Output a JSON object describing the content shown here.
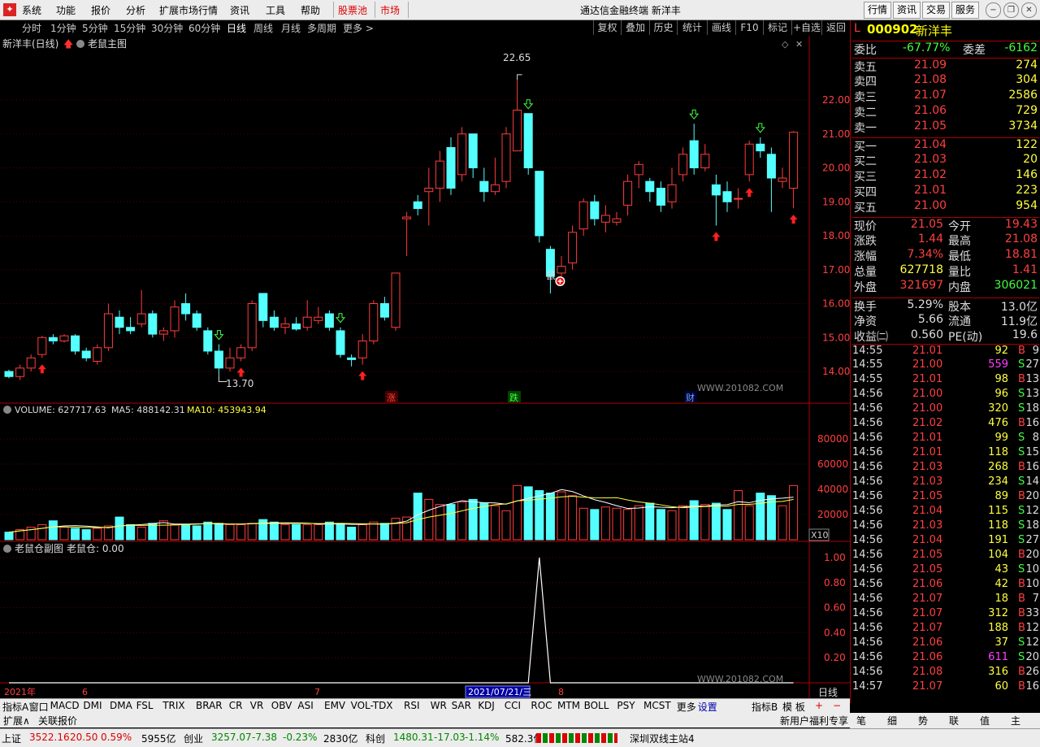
{
  "menu": {
    "items": [
      "系统",
      "功能",
      "报价",
      "分析",
      "扩展市场行情",
      "资讯",
      "工具",
      "帮助"
    ],
    "hot": "股票池",
    "market": "市场",
    "title": "通达信金融终端  新洋丰",
    "right_buttons": [
      "行情",
      "资讯",
      "交易",
      "服务"
    ]
  },
  "periods": [
    "分时",
    "1分钟",
    "5分钟",
    "15分钟",
    "30分钟",
    "60分钟",
    "日线",
    "周线",
    "月线",
    "多周期",
    "更多 >"
  ],
  "active_period": "日线",
  "toolbar": [
    "复权",
    "叠加",
    "历史",
    "统计",
    "画线",
    "F10",
    "标记",
    "+自选",
    "返回"
  ],
  "main_chart": {
    "title": "新洋丰(日线)",
    "indicator": "老鼠主图",
    "high_label": "22.65",
    "low_label": "13.70",
    "mouse_label": "鼠",
    "event_marks": [
      "涨",
      "跌",
      "财"
    ],
    "watermark": "WWW.201082.COM",
    "y_ticks": [
      "22.00",
      "21.00",
      "20.00",
      "19.00",
      "18.00",
      "17.00",
      "16.00",
      "15.00",
      "14.00"
    ]
  },
  "chart_data": [
    {
      "type": "candlestick",
      "title": "新洋丰(日线)",
      "ylim": [
        13.4,
        23.0
      ],
      "x_labels": [
        "2021年",
        "6",
        "7",
        "8"
      ],
      "candles": [
        {
          "o": 14.0,
          "c": 13.85,
          "h": 14.05,
          "l": 13.8
        },
        {
          "o": 13.85,
          "c": 14.1,
          "h": 14.2,
          "l": 13.75
        },
        {
          "o": 14.1,
          "c": 14.4,
          "h": 14.5,
          "l": 14.0
        },
        {
          "o": 14.5,
          "c": 15.0,
          "h": 15.05,
          "l": 14.4
        },
        {
          "o": 15.0,
          "c": 14.9,
          "h": 15.1,
          "l": 14.8
        },
        {
          "o": 14.9,
          "c": 15.05,
          "h": 15.1,
          "l": 14.85
        },
        {
          "o": 15.05,
          "c": 14.6,
          "h": 15.1,
          "l": 14.5
        },
        {
          "o": 14.6,
          "c": 14.4,
          "h": 14.7,
          "l": 14.3
        },
        {
          "o": 14.3,
          "c": 14.7,
          "h": 14.8,
          "l": 14.2
        },
        {
          "o": 14.7,
          "c": 15.7,
          "h": 16.0,
          "l": 14.6
        },
        {
          "o": 15.6,
          "c": 15.3,
          "h": 15.8,
          "l": 15.1
        },
        {
          "o": 15.3,
          "c": 15.2,
          "h": 15.6,
          "l": 15.1
        },
        {
          "o": 15.4,
          "c": 15.7,
          "h": 16.4,
          "l": 15.3
        },
        {
          "o": 15.7,
          "c": 15.1,
          "h": 15.8,
          "l": 15.0
        },
        {
          "o": 15.1,
          "c": 15.2,
          "h": 15.3,
          "l": 14.9
        },
        {
          "o": 15.2,
          "c": 15.9,
          "h": 16.1,
          "l": 15.0
        },
        {
          "o": 16.0,
          "c": 15.7,
          "h": 16.3,
          "l": 15.5
        },
        {
          "o": 15.7,
          "c": 15.3,
          "h": 15.8,
          "l": 15.2
        },
        {
          "o": 15.2,
          "c": 14.6,
          "h": 15.3,
          "l": 14.5
        },
        {
          "o": 14.6,
          "c": 14.1,
          "h": 14.8,
          "l": 13.9
        },
        {
          "o": 14.1,
          "c": 14.4,
          "h": 14.7,
          "l": 14.0
        },
        {
          "o": 14.4,
          "c": 14.7,
          "h": 14.8,
          "l": 14.3
        },
        {
          "o": 14.7,
          "c": 16.0,
          "h": 16.1,
          "l": 14.6
        },
        {
          "o": 16.3,
          "c": 15.5,
          "h": 16.3,
          "l": 15.3
        },
        {
          "o": 15.6,
          "c": 15.3,
          "h": 15.8,
          "l": 15.2
        },
        {
          "o": 15.3,
          "c": 15.4,
          "h": 15.6,
          "l": 15.1
        },
        {
          "o": 15.4,
          "c": 15.25,
          "h": 15.6,
          "l": 15.2
        },
        {
          "o": 15.3,
          "c": 15.6,
          "h": 16.1,
          "l": 15.2
        },
        {
          "o": 15.5,
          "c": 15.6,
          "h": 15.9,
          "l": 15.4
        },
        {
          "o": 15.7,
          "c": 15.3,
          "h": 15.8,
          "l": 15.2
        },
        {
          "o": 15.2,
          "c": 14.5,
          "h": 15.3,
          "l": 14.4
        },
        {
          "o": 14.4,
          "c": 14.35,
          "h": 14.5,
          "l": 14.15
        },
        {
          "o": 14.4,
          "c": 14.9,
          "h": 15.1,
          "l": 14.2
        },
        {
          "o": 14.9,
          "c": 16.0,
          "h": 16.1,
          "l": 14.8
        },
        {
          "o": 16.0,
          "c": 15.6,
          "h": 16.2,
          "l": 15.5
        },
        {
          "o": 15.3,
          "c": 16.9,
          "h": 16.9,
          "l": 15.2
        },
        {
          "o": 18.5,
          "c": 18.55,
          "h": 18.7,
          "l": 17.4
        },
        {
          "o": 19.0,
          "c": 18.8,
          "h": 19.2,
          "l": 18.6
        },
        {
          "o": 19.3,
          "c": 19.4,
          "h": 20.0,
          "l": 18.3
        },
        {
          "o": 19.4,
          "c": 20.2,
          "h": 20.5,
          "l": 19.0
        },
        {
          "o": 20.6,
          "c": 19.4,
          "h": 20.9,
          "l": 19.2
        },
        {
          "o": 19.8,
          "c": 21.0,
          "h": 21.2,
          "l": 19.6
        },
        {
          "o": 21.0,
          "c": 20.0,
          "h": 21.0,
          "l": 19.7
        },
        {
          "o": 19.6,
          "c": 19.3,
          "h": 20.0,
          "l": 19.0
        },
        {
          "o": 19.3,
          "c": 19.5,
          "h": 20.3,
          "l": 19.2
        },
        {
          "o": 19.6,
          "c": 21.0,
          "h": 21.2,
          "l": 19.4
        },
        {
          "o": 20.5,
          "c": 21.7,
          "h": 22.6,
          "l": 20.5
        },
        {
          "o": 21.6,
          "c": 20.0,
          "h": 21.6,
          "l": 19.8
        },
        {
          "o": 19.9,
          "c": 18.0,
          "h": 19.9,
          "l": 17.8
        },
        {
          "o": 17.6,
          "c": 16.8,
          "h": 17.7,
          "l": 16.3
        },
        {
          "o": 16.9,
          "c": 17.1,
          "h": 17.4,
          "l": 16.8
        },
        {
          "o": 17.2,
          "c": 18.1,
          "h": 18.3,
          "l": 17.0
        },
        {
          "o": 18.2,
          "c": 19.0,
          "h": 19.1,
          "l": 18.0
        },
        {
          "o": 19.0,
          "c": 18.5,
          "h": 19.2,
          "l": 18.3
        },
        {
          "o": 18.4,
          "c": 18.6,
          "h": 18.9,
          "l": 18.1
        },
        {
          "o": 18.4,
          "c": 18.5,
          "h": 18.7,
          "l": 18.3
        },
        {
          "o": 18.9,
          "c": 19.6,
          "h": 19.8,
          "l": 18.6
        },
        {
          "o": 19.8,
          "c": 20.1,
          "h": 20.2,
          "l": 19.4
        },
        {
          "o": 19.6,
          "c": 19.3,
          "h": 19.7,
          "l": 19.0
        },
        {
          "o": 19.4,
          "c": 18.9,
          "h": 19.6,
          "l": 18.7
        },
        {
          "o": 19.0,
          "c": 19.5,
          "h": 20.0,
          "l": 18.8
        },
        {
          "o": 19.8,
          "c": 20.4,
          "h": 20.6,
          "l": 19.6
        },
        {
          "o": 20.8,
          "c": 20.0,
          "h": 21.3,
          "l": 19.8
        },
        {
          "o": 20.0,
          "c": 20.4,
          "h": 20.7,
          "l": 19.9
        },
        {
          "o": 19.5,
          "c": 19.2,
          "h": 19.8,
          "l": 18.3
        },
        {
          "o": 19.3,
          "c": 19.0,
          "h": 19.6,
          "l": 18.7
        },
        {
          "o": 19.1,
          "c": 19.1,
          "h": 19.4,
          "l": 18.8
        },
        {
          "o": 19.8,
          "c": 20.7,
          "h": 20.8,
          "l": 19.6
        },
        {
          "o": 20.7,
          "c": 20.5,
          "h": 20.9,
          "l": 20.3
        },
        {
          "o": 20.4,
          "c": 19.7,
          "h": 20.6,
          "l": 18.7
        },
        {
          "o": 19.6,
          "c": 19.7,
          "h": 20.0,
          "l": 19.4
        },
        {
          "o": 19.4,
          "c": 21.05,
          "h": 21.08,
          "l": 18.81
        }
      ]
    },
    {
      "type": "bar",
      "title": "VOLUME",
      "ylim": [
        0,
        100000
      ],
      "values": [
        6,
        8,
        10,
        12,
        15,
        10,
        9,
        8,
        9,
        11,
        18,
        12,
        10,
        13,
        15,
        12,
        12,
        11,
        14,
        13,
        12,
        12,
        13,
        16,
        14,
        12,
        12,
        12,
        12,
        14,
        13,
        10,
        12,
        14,
        13,
        17,
        18,
        37,
        32,
        28,
        28,
        30,
        32,
        29,
        27,
        23,
        43,
        42,
        39,
        37,
        38,
        35,
        25,
        24,
        26,
        25,
        24,
        27,
        29,
        24,
        23,
        27,
        31,
        28,
        29,
        24,
        39,
        27,
        37,
        35,
        27,
        43
      ]
    },
    {
      "type": "line",
      "title": "老鼠仓副图",
      "ylim": [
        0,
        1.1
      ],
      "values": [
        0,
        0,
        0,
        0,
        0,
        0,
        0,
        0,
        0,
        0,
        0,
        0,
        0,
        0,
        0,
        0,
        0,
        0,
        0,
        0,
        0,
        0,
        0,
        0,
        0,
        0,
        0,
        0,
        0,
        0,
        0,
        0,
        0,
        0,
        0,
        0,
        0,
        0,
        0,
        0,
        0,
        0,
        0,
        0,
        0,
        0,
        0,
        0,
        1,
        0,
        0,
        0,
        0,
        0,
        0,
        0,
        0,
        0,
        0,
        0,
        0,
        0,
        0,
        0,
        0,
        0,
        0,
        0,
        0,
        0,
        0,
        0
      ]
    }
  ],
  "volume": {
    "label": "VOLUME: 627717.63",
    "ma5": "MA5: 488142.31",
    "ma10": "MA10: 453943.94",
    "unit": "X10",
    "y_ticks": [
      "80000",
      "60000",
      "40000",
      "20000"
    ]
  },
  "sub": {
    "label": "老鼠仓副图",
    "value": "老鼠仓: 0.00",
    "y_ticks": [
      "1.00",
      "0.80",
      "0.60",
      "0.40",
      "0.20"
    ],
    "date_box": "2021/07/21/三",
    "period": "日线"
  },
  "quote": {
    "code": "000902",
    "name": "新洋丰",
    "prefix": "L",
    "weibi_label": "委比",
    "weibi": "-67.77%",
    "weicha_label": "委差",
    "weicha": "-6162",
    "sell": [
      {
        "label": "卖五",
        "price": "21.09",
        "vol": "274"
      },
      {
        "label": "卖四",
        "price": "21.08",
        "vol": "304"
      },
      {
        "label": "卖三",
        "price": "21.07",
        "vol": "2586"
      },
      {
        "label": "卖二",
        "price": "21.06",
        "vol": "729"
      },
      {
        "label": "卖一",
        "price": "21.05",
        "vol": "3734"
      }
    ],
    "buy": [
      {
        "label": "买一",
        "price": "21.04",
        "vol": "122"
      },
      {
        "label": "买二",
        "price": "21.03",
        "vol": "20"
      },
      {
        "label": "买三",
        "price": "21.02",
        "vol": "146"
      },
      {
        "label": "买四",
        "price": "21.01",
        "vol": "223"
      },
      {
        "label": "买五",
        "price": "21.00",
        "vol": "954"
      }
    ],
    "stats": [
      {
        "a": "现价",
        "av": "21.05",
        "b": "今开",
        "bv": "19.43",
        "ac": "#ff4040",
        "bc": "#ff4040"
      },
      {
        "a": "涨跌",
        "av": "1.44",
        "b": "最高",
        "bv": "21.08",
        "ac": "#ff4040",
        "bc": "#ff4040"
      },
      {
        "a": "涨幅",
        "av": "7.34%",
        "b": "最低",
        "bv": "18.81",
        "ac": "#ff4040",
        "bc": "#ff4040"
      },
      {
        "a": "总量",
        "av": "627718",
        "b": "量比",
        "bv": "1.41",
        "ac": "#ffff40",
        "bc": "#ff4040"
      },
      {
        "a": "外盘",
        "av": "321697",
        "b": "内盘",
        "bv": "306021",
        "ac": "#ff4040",
        "bc": "#40ff40"
      },
      {
        "a": "换手",
        "av": "5.29%",
        "b": "股本",
        "bv": "13.0亿",
        "ac": "#ddd",
        "bc": "#ddd"
      },
      {
        "a": "净资",
        "av": "5.66",
        "b": "流通",
        "bv": "11.9亿",
        "ac": "#ddd",
        "bc": "#ddd"
      },
      {
        "a": "收益㈡",
        "av": "0.560",
        "b": "PE(动)",
        "bv": "19.6",
        "ac": "#ddd",
        "bc": "#ddd"
      }
    ],
    "ticks": [
      {
        "t": "14:55",
        "p": "21.01",
        "v": "92",
        "s": "B",
        "n": "9"
      },
      {
        "t": "14:55",
        "p": "21.00",
        "v": "559",
        "s": "S",
        "n": "27"
      },
      {
        "t": "14:55",
        "p": "21.01",
        "v": "98",
        "s": "B",
        "n": "13"
      },
      {
        "t": "14:56",
        "p": "21.00",
        "v": "96",
        "s": "S",
        "n": "13"
      },
      {
        "t": "14:56",
        "p": "21.00",
        "v": "320",
        "s": "S",
        "n": "18"
      },
      {
        "t": "14:56",
        "p": "21.02",
        "v": "476",
        "s": "B",
        "n": "16"
      },
      {
        "t": "14:56",
        "p": "21.01",
        "v": "99",
        "s": "S",
        "n": "8"
      },
      {
        "t": "14:56",
        "p": "21.01",
        "v": "118",
        "s": "S",
        "n": "15"
      },
      {
        "t": "14:56",
        "p": "21.03",
        "v": "268",
        "s": "B",
        "n": "16"
      },
      {
        "t": "14:56",
        "p": "21.03",
        "v": "234",
        "s": "S",
        "n": "14"
      },
      {
        "t": "14:56",
        "p": "21.05",
        "v": "89",
        "s": "B",
        "n": "20"
      },
      {
        "t": "14:56",
        "p": "21.04",
        "v": "115",
        "s": "S",
        "n": "12"
      },
      {
        "t": "14:56",
        "p": "21.03",
        "v": "118",
        "s": "S",
        "n": "18"
      },
      {
        "t": "14:56",
        "p": "21.04",
        "v": "191",
        "s": "S",
        "n": "27"
      },
      {
        "t": "14:56",
        "p": "21.05",
        "v": "104",
        "s": "B",
        "n": "20"
      },
      {
        "t": "14:56",
        "p": "21.05",
        "v": "43",
        "s": "S",
        "n": "10"
      },
      {
        "t": "14:56",
        "p": "21.06",
        "v": "42",
        "s": "B",
        "n": "10"
      },
      {
        "t": "14:56",
        "p": "21.07",
        "v": "18",
        "s": "B",
        "n": "7"
      },
      {
        "t": "14:56",
        "p": "21.07",
        "v": "312",
        "s": "B",
        "n": "33"
      },
      {
        "t": "14:56",
        "p": "21.07",
        "v": "188",
        "s": "B",
        "n": "12"
      },
      {
        "t": "14:56",
        "p": "21.06",
        "v": "37",
        "s": "S",
        "n": "12"
      },
      {
        "t": "14:56",
        "p": "21.06",
        "v": "611",
        "s": "S",
        "n": "20"
      },
      {
        "t": "14:56",
        "p": "21.08",
        "v": "316",
        "s": "B",
        "n": "26"
      },
      {
        "t": "14:57",
        "p": "21.07",
        "v": "60",
        "s": "B",
        "n": "16"
      }
    ]
  },
  "bottom_tabs": [
    "指标A",
    "窗口",
    "MACD",
    "DMI",
    "DMA",
    "FSL",
    "TRIX",
    "BRAR",
    "CR",
    "VR",
    "OBV",
    "ASI",
    "EMV",
    "VOL-TDX",
    "RSI",
    "WR",
    "SAR",
    "KDJ",
    "CCI",
    "ROC",
    "MTM",
    "BOLL",
    "PSY",
    "MCST",
    "更多",
    "设置"
  ],
  "bottom_right": [
    "指标B",
    "模 板"
  ],
  "bottom2": [
    "扩展∧",
    "关联报价"
  ],
  "status": [
    {
      "name": "上证",
      "v": "3522.16",
      "d": "20.50",
      "p": "0.59%",
      "a": "5955亿"
    },
    {
      "name": "创业",
      "v": "3257.07",
      "d": "-7.38",
      "p": "-0.23%",
      "a": "2830亿"
    },
    {
      "name": "科创",
      "v": "1480.31",
      "d": "-17.03",
      "p": "-1.14%",
      "a": "582.3亿"
    }
  ],
  "server": "深圳双线主站4",
  "promo": "新用户福利专享",
  "right_tabs": [
    "笔",
    "细",
    "势",
    "联",
    "值",
    "主"
  ]
}
